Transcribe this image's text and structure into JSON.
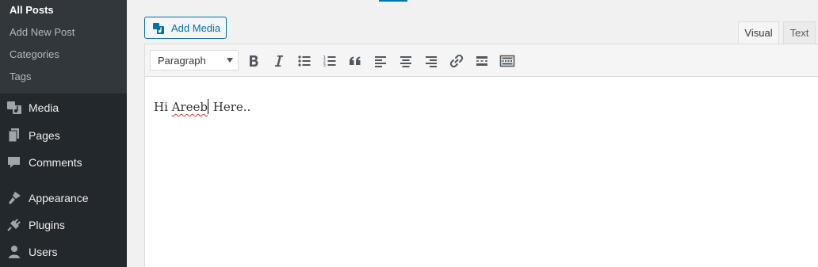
{
  "sidebar": {
    "submenu": [
      {
        "label": "All Posts",
        "current": true
      },
      {
        "label": "Add New Post",
        "current": false
      },
      {
        "label": "Categories",
        "current": false
      },
      {
        "label": "Tags",
        "current": false
      }
    ],
    "menu": [
      {
        "label": "Media",
        "icon": "media-icon"
      },
      {
        "label": "Pages",
        "icon": "pages-icon"
      },
      {
        "label": "Comments",
        "icon": "comments-icon"
      },
      {
        "label": "Appearance",
        "icon": "appearance-icon"
      },
      {
        "label": "Plugins",
        "icon": "plugins-icon"
      },
      {
        "label": "Users",
        "icon": "users-icon"
      }
    ]
  },
  "editor": {
    "add_media_label": "Add Media",
    "tabs": {
      "visual": "Visual",
      "text": "Text",
      "active": "visual"
    },
    "format_select_value": "Paragraph",
    "toolbar_buttons": [
      "bold-icon",
      "italic-icon",
      "bulleted-list-icon",
      "numbered-list-icon",
      "blockquote-icon",
      "align-left-icon",
      "align-center-icon",
      "align-right-icon",
      "link-icon",
      "read-more-icon",
      "toolbar-toggle-icon"
    ],
    "content": {
      "before": "Hi ",
      "misspelled": "Areeb",
      "after": " Here.."
    }
  },
  "colors": {
    "sidebar_bg": "#23282d",
    "submenu_bg": "#32373c",
    "accent": "#0073aa",
    "spellcheck": "#d63638"
  }
}
